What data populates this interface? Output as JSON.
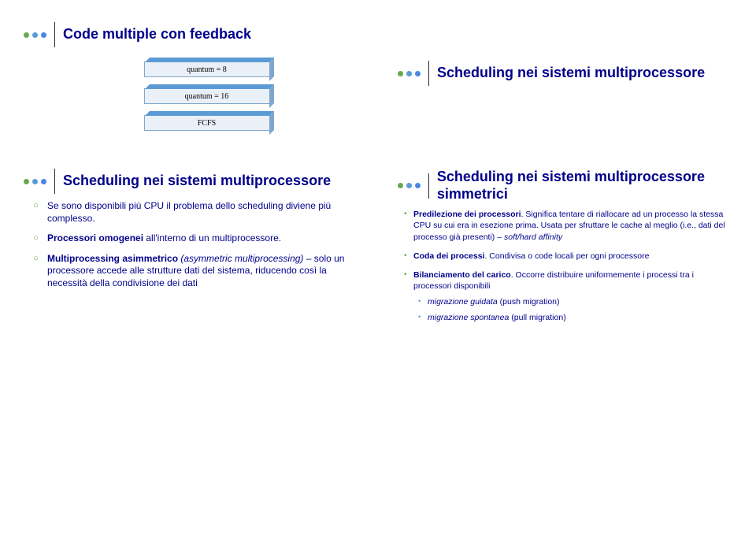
{
  "slides": {
    "topLeft": {
      "title": "Code multiple con feedback",
      "diagram": {
        "box1": "quantum = 8",
        "box2": "quantum = 16",
        "box3": "FCFS"
      }
    },
    "topRight": {
      "title": "Scheduling nei sistemi multiprocessore"
    },
    "bottomLeft": {
      "title": "Scheduling nei sistemi multiprocessore",
      "items": {
        "b1": "Se sono disponibili più CPU il problema dello scheduling diviene più complesso.",
        "b2_pre": "Processori omogenei",
        "b2_post": " all'interno di un multiprocessore.",
        "b3_pre": "Multiprocessing asimmetrico ",
        "b3_it": "(asymmetric multiprocessing)",
        "b3_post": " – solo un processore accede alle strutture dati del sistema, riducendo così la necessità della condivisione dei dati"
      }
    },
    "bottomRight": {
      "title": "Scheduling nei sistemi multiprocessore simmetrici",
      "items": {
        "p1_t": "Predilezione dei processori",
        "p1_r": ". Significa tentare di riallocare ad un processo la stessa CPU su cui era in esezione prima. Usata per sfruttare le cache al meglio (i.e., dati del processo già presenti) – ",
        "p1_it": "soft/hard affinity",
        "p2_t": "Coda dei processi",
        "p2_r": ". Condivisa o code locali per ogni processore",
        "p3_t": "Bilanciamento del carico",
        "p3_r": ". Occorre distribuire uniformemente i processi tra i processori disponibili",
        "s1_it": "migrazione guidata",
        "s1_r": " (push migration)",
        "s2_it": "migrazione spontanea",
        "s2_r": " (pull migration)"
      }
    }
  }
}
